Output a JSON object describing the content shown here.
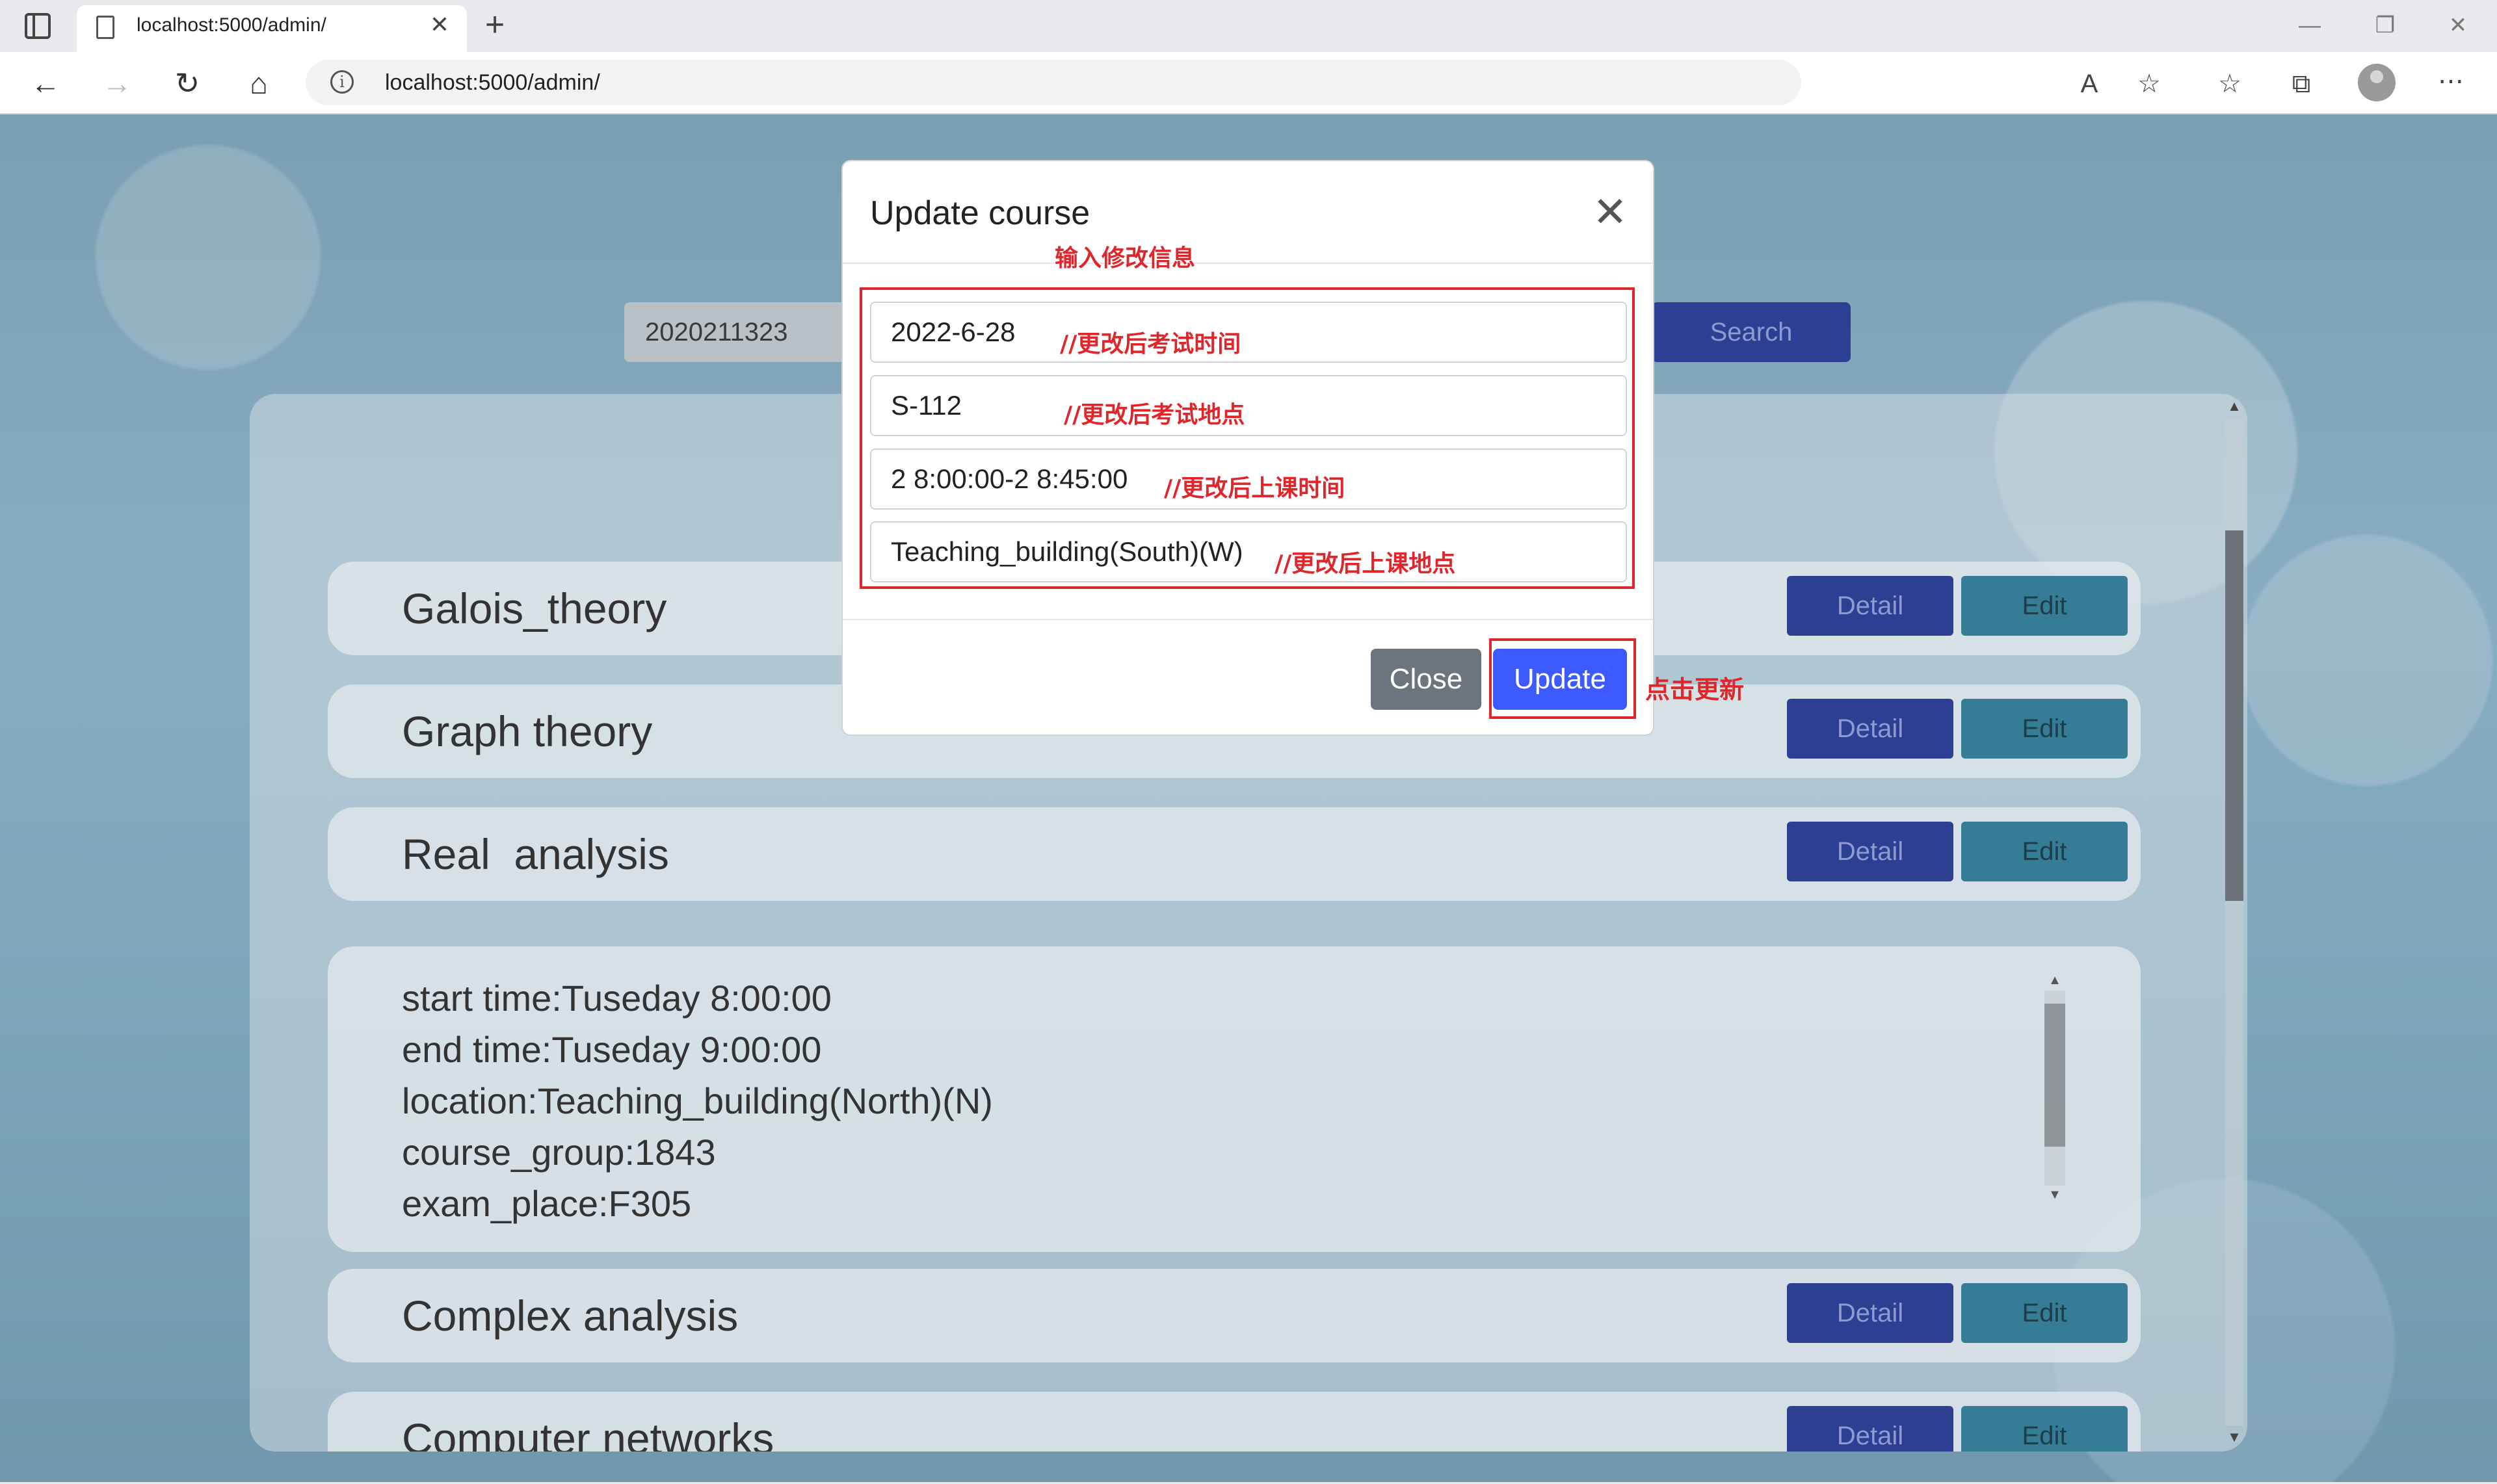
{
  "browser": {
    "tab_title": "localhost:5000/admin/",
    "tab_close": "✕",
    "new_tab": "+",
    "address": "localhost:5000/admin/",
    "controls": {
      "minimize": "—",
      "restore": "❐",
      "close": "✕"
    },
    "icons": [
      "back-icon",
      "forward-icon",
      "refresh-icon",
      "home-icon",
      "read-aloud-icon",
      "favorite-add-icon",
      "favorites-icon",
      "collections-icon",
      "profile-icon",
      "more-icon"
    ]
  },
  "search": {
    "value": "2020211323",
    "button_label": "Search"
  },
  "courses": [
    {
      "name": "Galois_theory",
      "detail_label": "Detail",
      "edit_label": "Edit"
    },
    {
      "name": "Graph theory",
      "detail_label": "Detail",
      "edit_label": "Edit"
    },
    {
      "name": "Real  analysis",
      "detail_label": "Detail",
      "edit_label": "Edit"
    },
    {
      "name": "Complex analysis",
      "detail_label": "Detail",
      "edit_label": "Edit"
    },
    {
      "name": "Computer networks",
      "detail_label": "Detail",
      "edit_label": "Edit"
    }
  ],
  "detail": {
    "lines": [
      "start time:Tuseday 8:00:00",
      "end time:Tuseday 9:00:00",
      "location:Teaching_building(North)(N)",
      "course_group:1843",
      "exam_place:F305"
    ]
  },
  "modal": {
    "title": "Update course",
    "close_icon": "✕",
    "fields": [
      {
        "value": "2022-6-28",
        "annotation": "//更改后考试时间"
      },
      {
        "value": "S-112",
        "annotation": "//更改后考试地点"
      },
      {
        "value": "2 8:00:00-2 8:45:00",
        "annotation": "//更改后上课时间"
      },
      {
        "value": "Teaching_building(South)(W)",
        "annotation": "//更改后上课地点"
      }
    ],
    "header_annotation": "输入修改信息",
    "close_label": "Close",
    "update_label": "Update",
    "update_annotation": "点击更新"
  },
  "colors": {
    "primary": "#3d5afe",
    "secondary": "#6c757d",
    "annotation": "#e0262b"
  }
}
